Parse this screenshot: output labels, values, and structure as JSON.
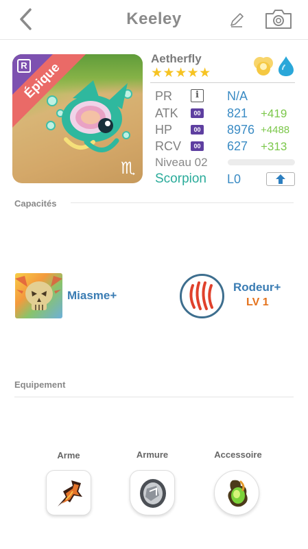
{
  "header": {
    "title": "Keeley"
  },
  "card": {
    "rarity_label": "Épique",
    "rarity_badge": "R",
    "zodiac_glyph": "♏"
  },
  "pet": {
    "name": "Aetherfly",
    "stars": "★★★★★",
    "elements": [
      "light-element-icon",
      "water-element-icon"
    ]
  },
  "stats": [
    {
      "label": "PR",
      "value": "N/A",
      "bonus": "",
      "badge": "i"
    },
    {
      "label": "ATK",
      "value": "821",
      "bonus": "+419",
      "badge": "00"
    },
    {
      "label": "HP",
      "value": "8976",
      "bonus": "+4488",
      "badge": "00"
    },
    {
      "label": "RCV",
      "value": "627",
      "bonus": "+313",
      "badge": "00"
    }
  ],
  "level": {
    "label": "Niveau 02",
    "progress": 0.0
  },
  "sign": {
    "name": "Scorpion",
    "limit": "L0"
  },
  "sections": {
    "abilities": "Capacités",
    "equipment": "Equipement"
  },
  "skills": [
    {
      "name": "Miasme+",
      "icon": "skull-icon",
      "level": ""
    },
    {
      "name": "Rodeur+",
      "icon": "claw-icon",
      "level": "LV 1"
    }
  ],
  "equipment": [
    {
      "label": "Arme",
      "icon": "weapon-icon"
    },
    {
      "label": "Armure",
      "icon": "armor-icon"
    },
    {
      "label": "Accessoire",
      "icon": "accessory-icon"
    }
  ],
  "colors": {
    "accent_blue": "#3a8bc4",
    "bonus_green": "#7bc74a",
    "rarity_red": "#ea6a67",
    "rarity_purple": "#7d51b0",
    "sign_teal": "#2aab9a",
    "level_orange": "#e4721c"
  }
}
